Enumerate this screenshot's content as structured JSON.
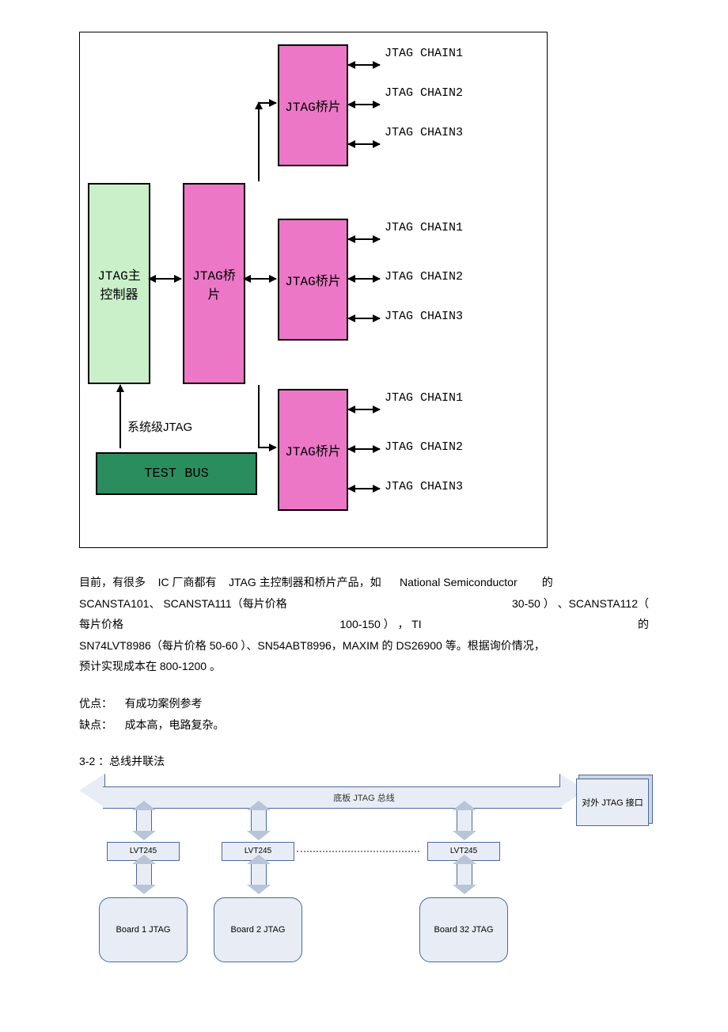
{
  "diagram1": {
    "controller": "JTAG主\n控制器",
    "bridge": "JTAG桥\n片",
    "bridge_short": "JTAG桥片",
    "testbus": "TEST BUS",
    "syslabel": "系统级JTAG",
    "chain1": "JTAG CHAIN1",
    "chain2": "JTAG CHAIN2",
    "chain3": "JTAG CHAIN3"
  },
  "para1": {
    "l1a": "目前，有很多",
    "l1b": "IC 厂商都有",
    "l1c": "JTAG 主控制器和桥片产品，如",
    "l1d": "National Semiconductor",
    "l1e": "的",
    "l2a": "SCANSTA101、 SCANSTA111（每片价格",
    "l2b": "30-50 ） 、SCANSTA112（",
    "l3a": "每片价格",
    "l3b": "100-150 ） ，  TI",
    "l3c": "的",
    "l4": "SN74LVT8986（每片价格 50-60 ）、SN54ABT8996，MAXIM 的 DS26900 等。根据询价情况，",
    "l5": "预计实现成本在 800-1200 。"
  },
  "pros": {
    "label": "优点：",
    "text": "有成功案例参考"
  },
  "cons": {
    "label": "缺点：",
    "text": "成本高，电路复杂。"
  },
  "section": "3-2  ：总线并联法",
  "diagram2": {
    "buslabel": "底板 JTAG 总线",
    "extport": "对外 JTAG 接口",
    "lvt": "LVT245",
    "board1": "Board 1 JTAG",
    "board2": "Board 2 JTAG",
    "board32": "Board 32 JTAG"
  }
}
